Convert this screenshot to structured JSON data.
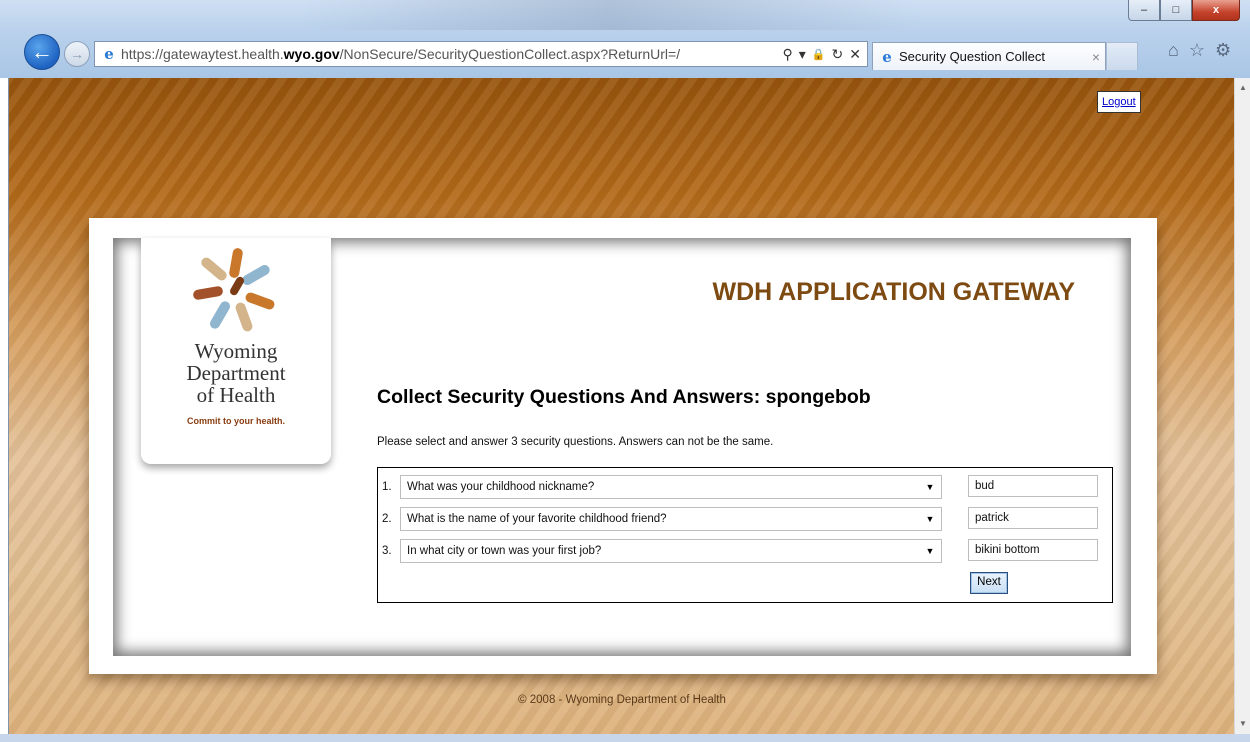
{
  "browser": {
    "url_scheme": "https://gatewaytest.health.",
    "url_domain": "wyo.gov",
    "url_path": "/NonSecure/SecurityQuestionCollect.aspx?ReturnUrl=/",
    "tab_title": "Security Question Collect",
    "tab_close": "×",
    "win_min": "–",
    "win_max": "□",
    "win_close": "x",
    "back_glyph": "←",
    "fwd_glyph": "→",
    "search_glyph": "⚲",
    "dropdown_glyph": "▾",
    "lock_glyph": "🔒",
    "refresh_glyph": "↻",
    "stop_glyph": "✕",
    "home_glyph": "⌂",
    "fav_glyph": "☆",
    "tools_glyph": "⚙"
  },
  "page": {
    "logout_label": "Logout",
    "logo": {
      "line1": "Wyoming",
      "line2": "Department",
      "line3": "of Health",
      "tagline": "Commit to your health."
    },
    "gateway_title": "WDH APPLICATION GATEWAY",
    "section_title": "Collect Security Questions And Answers: spongebob",
    "instructions": "Please select and answer 3 security questions. Answers can not be the same.",
    "questions": [
      {
        "num": "1.",
        "question": "What was your childhood nickname?",
        "answer": "bud"
      },
      {
        "num": "2.",
        "question": "What is the name of your favorite childhood friend?",
        "answer": "patrick"
      },
      {
        "num": "3.",
        "question": "In what city or town was your first job?",
        "answer": "bikini bottom"
      }
    ],
    "next_label": "Next",
    "footer": "© 2008 - Wyoming Department of Health"
  },
  "colors": {
    "title_brown": "#7d4a12",
    "accent_blue": "#1f63c2"
  }
}
